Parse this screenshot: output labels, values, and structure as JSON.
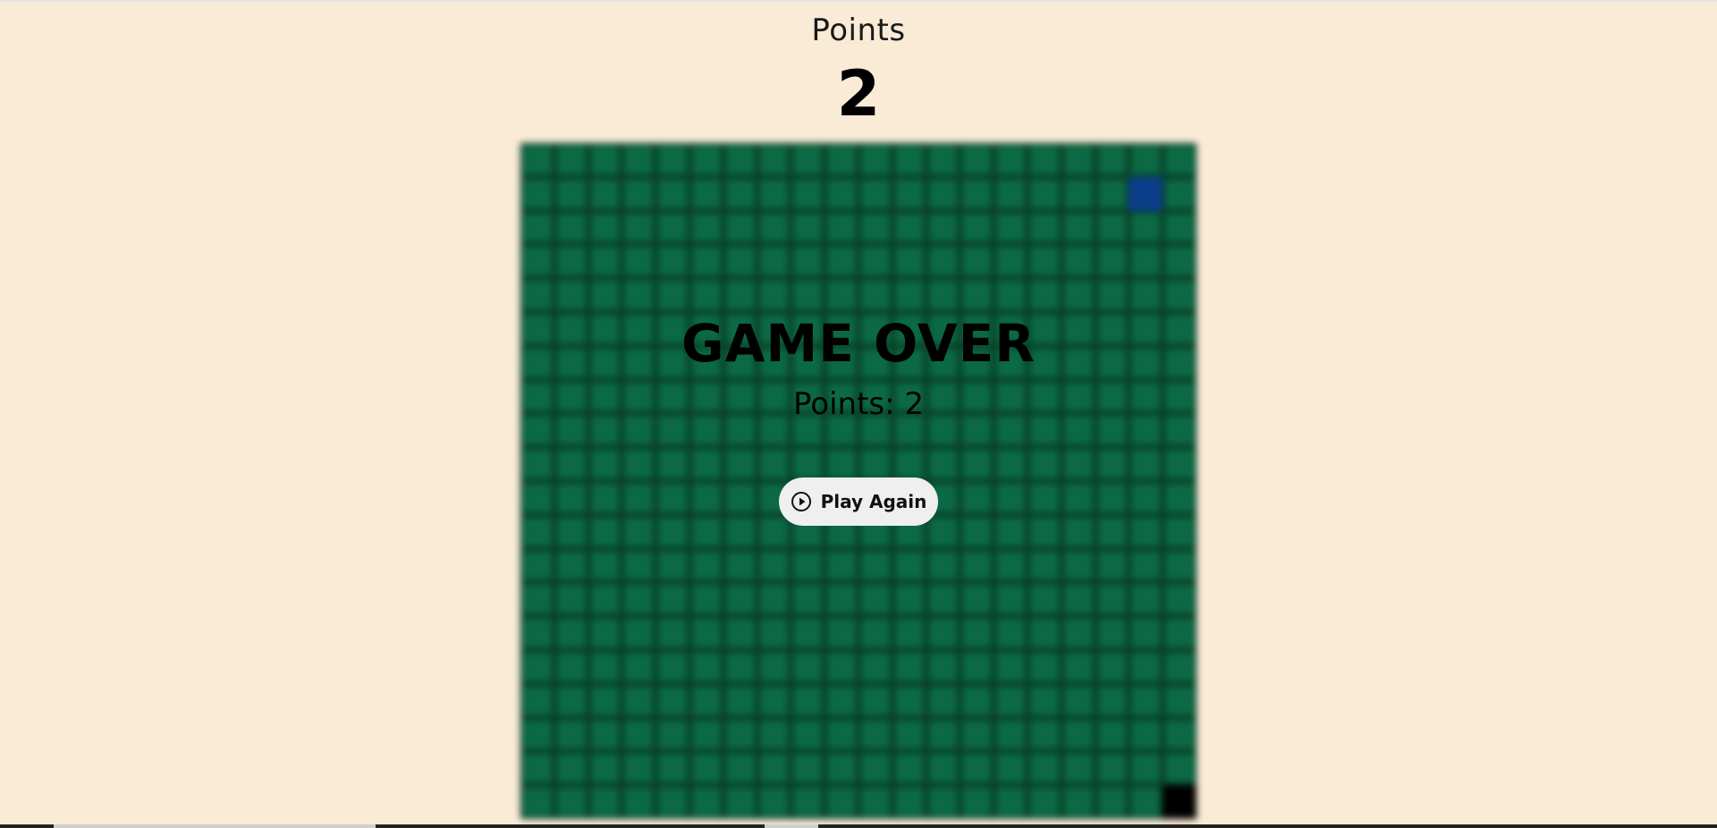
{
  "score": {
    "label": "Points",
    "value": "2"
  },
  "board": {
    "columns": 20,
    "rows": 20,
    "food_cell": [
      18,
      1
    ],
    "snake_cells": [
      [
        19,
        19
      ]
    ],
    "colors": {
      "board": "#0b6a45",
      "grid_line": "#083d26",
      "food": "#0b3d8a",
      "snake": "#000000",
      "background": "#faebd7"
    }
  },
  "game_over": {
    "title": "GAME OVER",
    "points_text": "Points: 2",
    "play_again_label": "Play Again",
    "play_icon": "play-circle-icon"
  }
}
